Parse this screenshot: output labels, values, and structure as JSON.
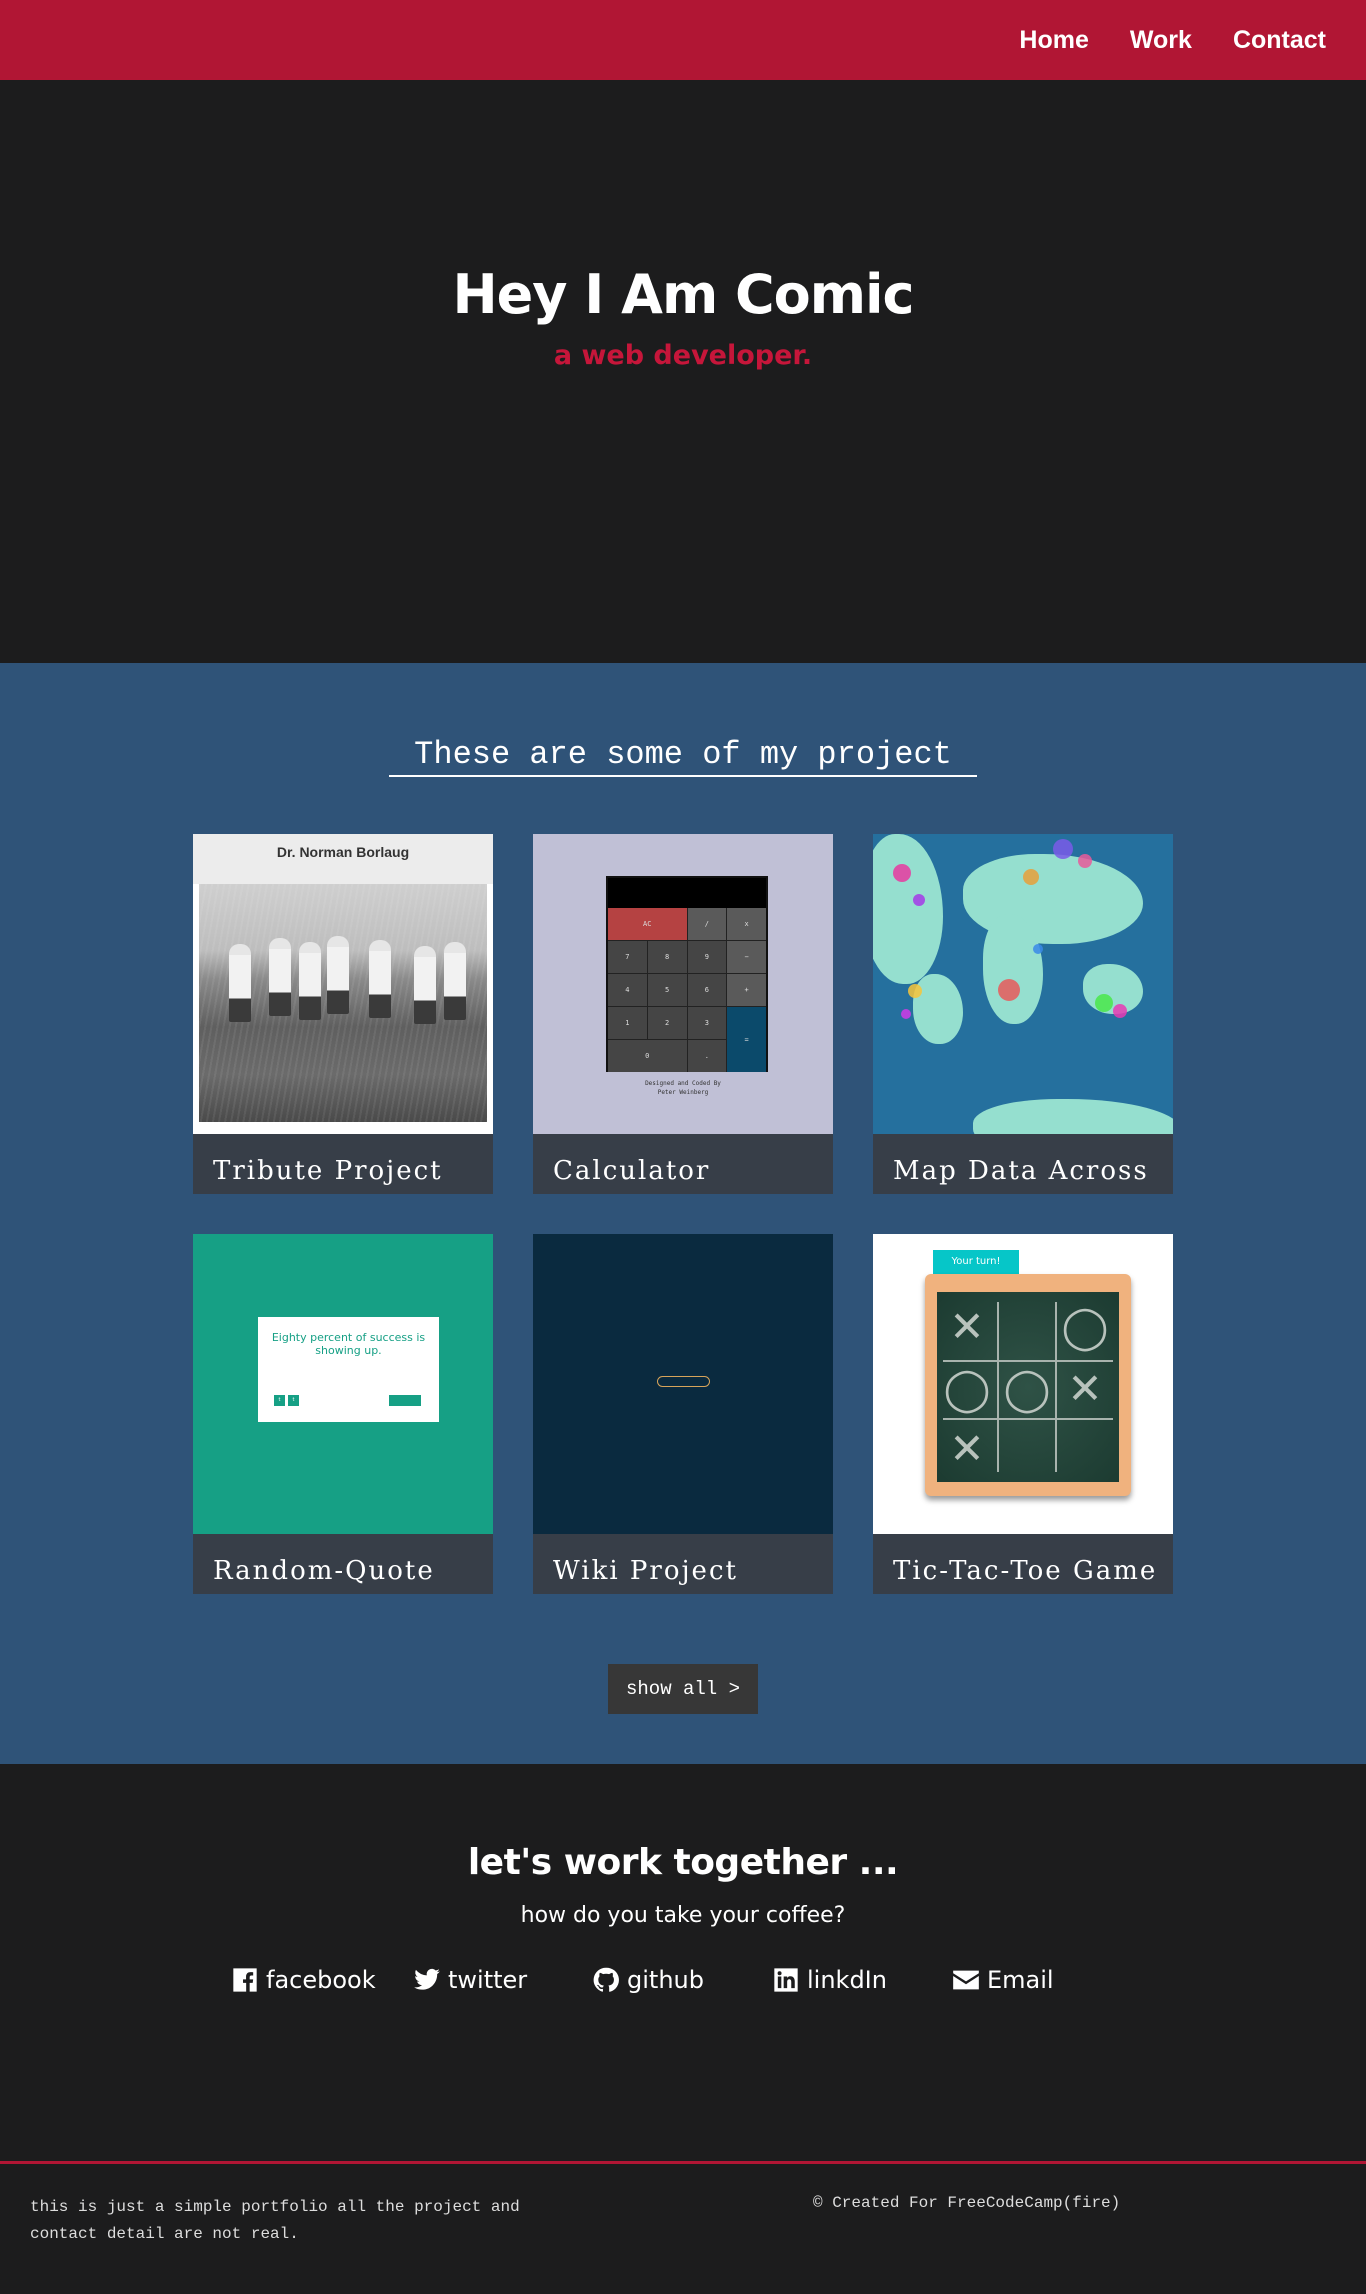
{
  "nav": {
    "items": [
      {
        "label": "Home"
      },
      {
        "label": "Work"
      },
      {
        "label": "Contact"
      }
    ]
  },
  "hero": {
    "title": "Hey I Am Comic",
    "subtitle": "a web developer."
  },
  "projects": {
    "heading": "These are some of my project",
    "cards": [
      {
        "label": "Tribute Project",
        "thumb_title": "Dr. Norman Borlaug"
      },
      {
        "label": "Calculator",
        "thumb_credit": "Designed and Coded By",
        "thumb_credit2": "Peter Weinberg"
      },
      {
        "label": "Map Data Across"
      },
      {
        "label": "Random-Quote",
        "thumb_quote": "Eighty percent of success is showing up."
      },
      {
        "label": "Wiki Project"
      },
      {
        "label": "Tic-Tac-Toe Game",
        "thumb_tag": "Your turn!"
      }
    ],
    "show_all": "show all >"
  },
  "contact": {
    "heading": "let's work together ...",
    "question": "how do you take your coffee?",
    "links": [
      {
        "label": "facebook",
        "icon": "facebook-icon"
      },
      {
        "label": "twitter",
        "icon": "twitter-icon"
      },
      {
        "label": "github",
        "icon": "github-icon"
      },
      {
        "label": "linkdIn",
        "icon": "linkedin-icon"
      },
      {
        "label": "Email",
        "icon": "envelope-icon"
      }
    ]
  },
  "footer": {
    "note": "this is just a simple portfolio all the project and contact detail are not real.",
    "credit": "© Created For FreeCodeCamp(fire)"
  },
  "colors": {
    "accent": "#b11634",
    "projects_bg": "#2f5378",
    "dark_bg": "#1c1c1d"
  }
}
